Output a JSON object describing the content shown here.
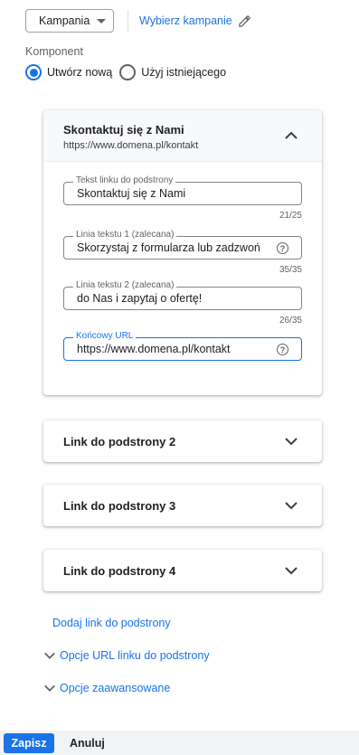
{
  "top": {
    "campaign_select": "Kampania",
    "choose_campaigns_link": "Wybierz kampanie"
  },
  "component": {
    "label": "Komponent",
    "option_new": "Utwórz nową",
    "option_existing": "Użyj istniejącego",
    "selected": "new"
  },
  "expanded_card": {
    "title": "Skontaktuj się z Nami",
    "url": "https://www.domena.pl/kontakt",
    "fields": [
      {
        "label": "Tekst linku do podstrony",
        "value": "Skontaktuj się z Nami",
        "counter": "21/25"
      },
      {
        "label": "Linia tekstu 1 (zalecana)",
        "value": "Skorzystaj z formularza lub zadzwoń",
        "counter": "35/35"
      },
      {
        "label": "Linia tekstu 2 (zalecana)",
        "value": "do Nas i zapytaj o ofertę!",
        "counter": "26/35"
      },
      {
        "label": "Końcowy URL",
        "value": "https://www.domena.pl/kontakt"
      }
    ]
  },
  "collapsed_cards": [
    {
      "title": "Link do podstrony 2"
    },
    {
      "title": "Link do podstrony 3"
    },
    {
      "title": "Link do podstrony 4"
    }
  ],
  "links": {
    "add_sitelink": "Dodaj link do podstrony",
    "url_options": "Opcje URL linku do podstrony",
    "advanced_options": "Opcje zaawansowane"
  },
  "footer": {
    "save": "Zapisz",
    "cancel": "Anuluj"
  },
  "colors": {
    "accent": "#1a73e8"
  }
}
